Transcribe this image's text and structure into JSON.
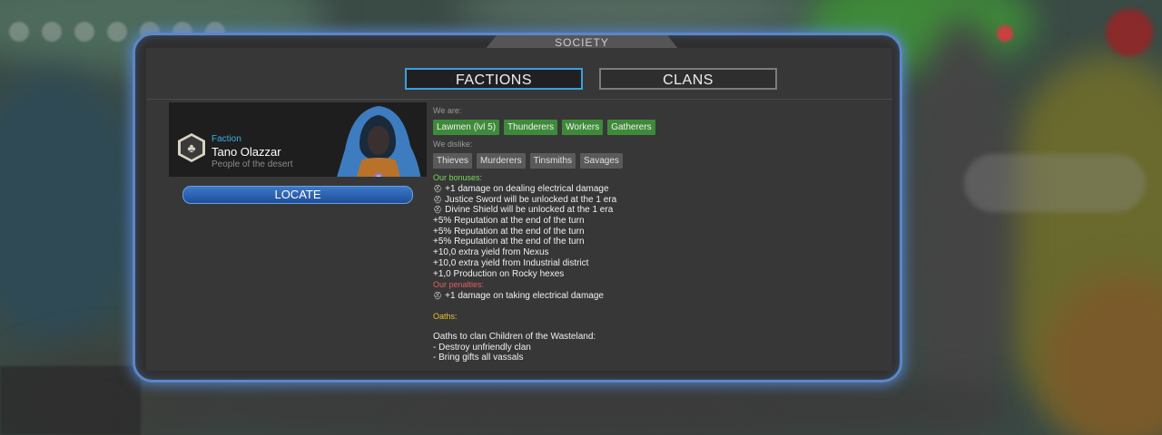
{
  "window": {
    "title": "SOCIETY"
  },
  "tabs": [
    {
      "label": "FACTIONS",
      "active": true
    },
    {
      "label": "CLANS",
      "active": false
    }
  ],
  "faction": {
    "type": "Faction",
    "name": "Tano Olazzar",
    "description": "People of the desert",
    "icon": "tree-emblem-icon",
    "locate_label": "LOCATE"
  },
  "relations": {
    "we_are_label": "We are:",
    "we_are": [
      "Lawmen (lvl 5)",
      "Thunderers",
      "Workers",
      "Gatherers"
    ],
    "we_dislike_label": "We dislike:",
    "we_dislike": [
      "Thieves",
      "Murderers",
      "Tinsmiths",
      "Savages"
    ]
  },
  "bonuses": {
    "label": "Our bonuses:",
    "items": [
      {
        "icon": "unit-icon",
        "text": "+1 damage on dealing electrical damage"
      },
      {
        "icon": "unit-icon",
        "text": "Justice Sword will be unlocked at the 1 era"
      },
      {
        "icon": "unit-icon",
        "text": "Divine Shield will be unlocked at the 1 era"
      },
      {
        "icon": "",
        "text": "+5% Reputation at the end of the turn"
      },
      {
        "icon": "",
        "text": "+5% Reputation at the end of the turn"
      },
      {
        "icon": "",
        "text": "+5% Reputation at the end of the turn"
      },
      {
        "icon": "",
        "text": "+10,0 extra yield from Nexus"
      },
      {
        "icon": "",
        "text": "+10,0 extra yield from Industrial district"
      },
      {
        "icon": "",
        "text": "+1,0 Production on Rocky hexes"
      }
    ]
  },
  "penalties": {
    "label": "Our penalties:",
    "items": [
      {
        "icon": "unit-icon",
        "text": "+1 damage on taking electrical damage"
      }
    ]
  },
  "oaths": {
    "label": "Oaths:",
    "heading": "Oaths to clan Children of the Wasteland:",
    "items": [
      "- Destroy unfriendly clan",
      "- Bring gifts all vassals"
    ]
  },
  "colors": {
    "accent": "#3aa0e0",
    "panel_glow": "#5c86c8",
    "good_tag": "#3e8a3a",
    "bonus_text": "#7ad85a",
    "penalty_text": "#e06060",
    "oath_text": "#e6c22a"
  }
}
